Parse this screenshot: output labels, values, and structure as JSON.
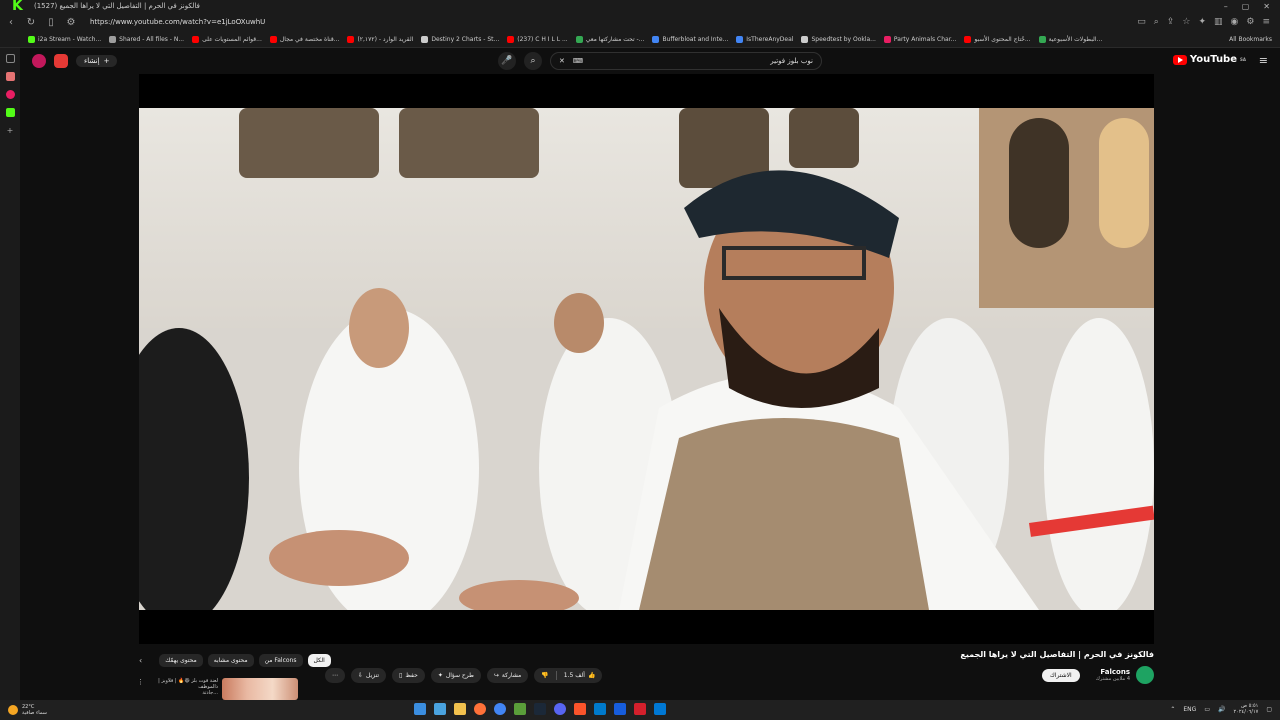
{
  "browser": {
    "tab_title": "(1527) فالكونز في الحرم | التفاصيل التي لا يراها الجميع",
    "url": "https://www.youtube.com/watch?v=e1jLoOXuwhU",
    "window_controls": [
      "–",
      "▢",
      "✕"
    ],
    "bookmarks": [
      {
        "label": "i2a Stream - Watch...",
        "color": "#53fc18"
      },
      {
        "label": "Shared - All files - N...",
        "color": "#9e9e9e"
      },
      {
        "label": "قوائم المستويات على...",
        "color": "#ff0000"
      },
      {
        "label": "قناة مختصة في مجال...",
        "color": "#ff0000"
      },
      {
        "label": "القريد الوارد - (٢,١٧٢)",
        "color": "#ff0000"
      },
      {
        "label": "Destiny 2 Charts - St...",
        "color": "#cccccc"
      },
      {
        "label": "(237) C H I L L ...",
        "color": "#ff0000"
      },
      {
        "label": "تحت مشاركتها معي -...",
        "color": "#34a853"
      },
      {
        "label": "Bufferbloat and Inte...",
        "color": "#4285f4"
      },
      {
        "label": "IsThereAnyDeal",
        "color": "#4285f4"
      },
      {
        "label": "Speedtest by Ookla...",
        "color": "#cccccc"
      },
      {
        "label": "Party Animals Char...",
        "color": "#e91e63"
      },
      {
        "label": "حُتاج المحتوى الأسبو...",
        "color": "#ff0000"
      },
      {
        "label": "البطولات الأسبوعية...",
        "color": "#34a853"
      }
    ],
    "all_bookmarks": "All Bookmarks"
  },
  "youtube": {
    "create_label": "إنشاء",
    "search_value": "نوب بلوز فوتير",
    "logo_text": "YouTube",
    "logo_region": "SA"
  },
  "video": {
    "title": "فالكونز في الحرم | التفاصيل التي لا يراها الجميع",
    "channel": "Falcons",
    "subscribers": "4 ملايين مشترك",
    "subscribe_label": "الاشتراك",
    "likes": "1.5 ألف",
    "share": "مشاركة",
    "ask": "طرح سؤال",
    "save": "حفظ",
    "download": "تنزيل",
    "more": "⋯"
  },
  "chips": [
    {
      "label": "الكل",
      "active": true
    },
    {
      "label": "من Falcons",
      "active": false
    },
    {
      "label": "محتوى مشابه",
      "active": false
    },
    {
      "label": "محتوى يهمّك",
      "active": false
    }
  ],
  "recommendation": {
    "title": "لعنة فوت بلز 😆🔥 | فلاويز | ذالموظف",
    "meta": "...جادتة"
  },
  "taskbar": {
    "temp": "22°C",
    "weather_desc": "سماء صافية",
    "lang": "ENG",
    "time": "٥:٥١ ص",
    "date": "٢٠٢٤/٠٦/١٧"
  }
}
